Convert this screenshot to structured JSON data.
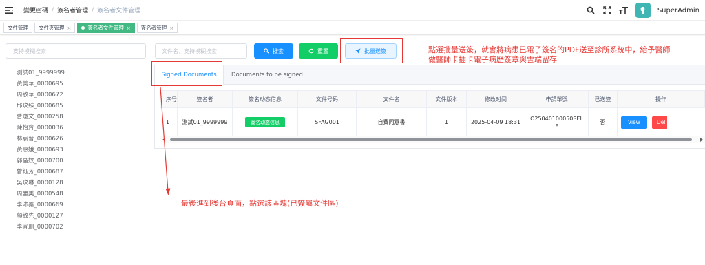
{
  "header": {
    "breadcrumbs": [
      "變更密碼",
      "簽名者管理",
      "簽名者文件管理"
    ],
    "username": "SuperAdmin"
  },
  "tags": [
    {
      "label": "文件管理",
      "closable": false,
      "active": false
    },
    {
      "label": "文件夾管理",
      "closable": true,
      "active": false
    },
    {
      "label": "簽名者文件管理",
      "closable": true,
      "active": true
    },
    {
      "label": "簽名者管理",
      "closable": true,
      "active": false
    }
  ],
  "sidebar": {
    "search_placeholder": "支持模糊搜索",
    "items": [
      "測試01_9999999",
      "黃美華_0000695",
      "周敏華_0000672",
      "邱玟臻_0000685",
      "曹瓊文_0000258",
      "陳怡齊_0000036",
      "林宸晉_0000626",
      "黃惠娥_0000693",
      "郭晶妏_0000700",
      "曾鈺芳_0000687",
      "吳玟琳_0000128",
      "周麗美_0000548",
      "李沛蓁_0000669",
      "顏敏先_0000127",
      "李宜珊_0000702"
    ]
  },
  "filters": {
    "search_placeholder": "文件名，支持模糊搜索",
    "search_label": "搜索",
    "reset_label": "重置",
    "batch_label": "批量送簽"
  },
  "tabs": {
    "signed": "Signed Documents",
    "to_be_signed": "Documents to be signed"
  },
  "table": {
    "headers": [
      "序号",
      "簽名者",
      "簽名动态信息",
      "文件号码",
      "文件名",
      "文件版本",
      "修改时间",
      "申請單號",
      "已送簽",
      "操作"
    ],
    "rows": [
      {
        "index": "1",
        "signer": "測試01_9999999",
        "dynamic_info": "簽名动态信息",
        "doc_no": "SFAG001",
        "doc_name": "自費同意書",
        "version": "1",
        "modified": "2025-04-09 18:31",
        "request_no_1": "O25040100050SEL",
        "request_no_2": "F",
        "sent": "否",
        "view": "View",
        "del": "Del"
      }
    ]
  },
  "annotations": {
    "note_top_line1": "點選批量送簽，就會將病患已電子簽名的PDF送至診所系統中，給予醫師",
    "note_top_line2": "做醫師卡插卡電子病歷簽章與雲端留存",
    "note_bottom": "最後進到後台頁面，點選該區塊(已簽屬文件區)"
  },
  "colors": {
    "primary": "#1890ff",
    "success": "#13ce66",
    "danger": "#ff4949",
    "annotation": "#e53935",
    "tag_active": "#42b983"
  }
}
